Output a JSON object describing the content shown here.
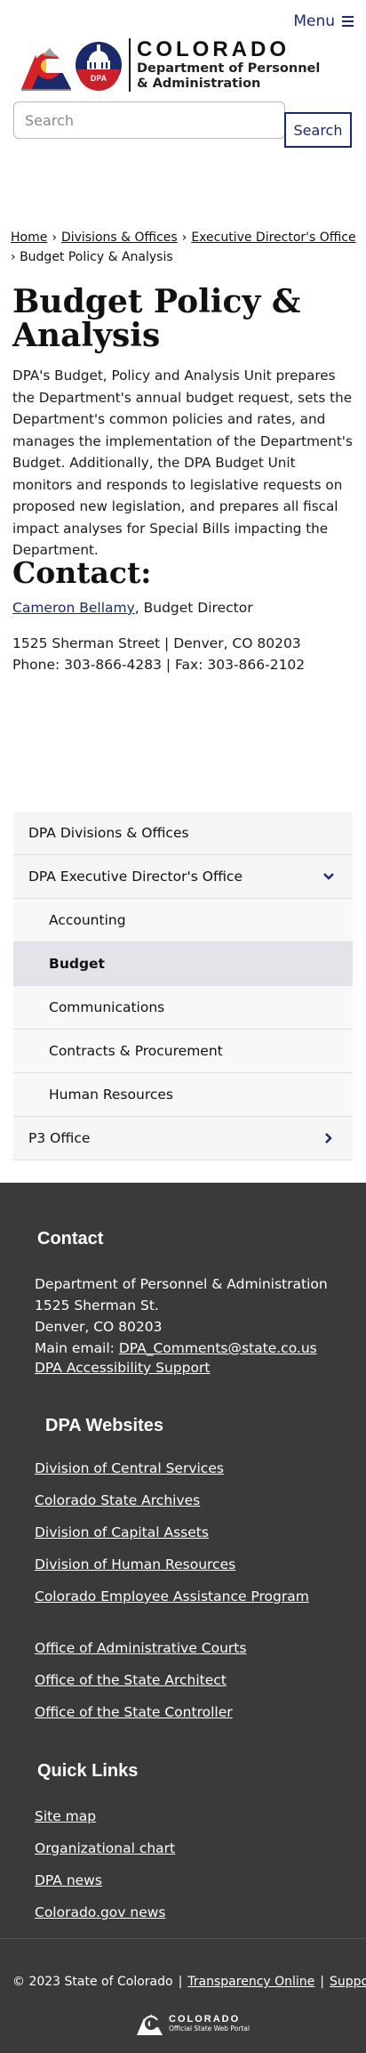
{
  "header": {
    "menu_label": "Menu",
    "logo_state": "COLORADO",
    "logo_dept_line1": "Department of Personnel",
    "logo_dept_line2": "& Administration",
    "logo_badge": "DPA",
    "search_placeholder": "Search",
    "search_button": "Search"
  },
  "breadcrumb": {
    "items": [
      "Home",
      "Divisions & Offices",
      "Executive Director's Office"
    ],
    "current": "Budget Policy & Analysis",
    "separator": "›"
  },
  "main": {
    "title": "Budget Policy & Analysis",
    "intro": "DPA's Budget, Policy and Analysis Unit prepares the Department's annual budget request, sets the Department's common policies and rates, and manages the implementation of the Department's Budget. Additionally, the DPA Budget Unit monitors and responds to legislative requests on proposed new legislation, and prepares all fiscal impact analyses for Special Bills impacting the Department.",
    "contact_heading": "Contact:",
    "contact_name": "Cameron Bellamy",
    "contact_role": ", Budget Director",
    "address_line": "1525 Sherman Street | Denver, CO 80203",
    "phone_line": "Phone: 303-866-4283 | Fax: 303-866-2102"
  },
  "sidenav": {
    "items": [
      {
        "label": "DPA Divisions & Offices"
      },
      {
        "label": "DPA Executive Director's Office",
        "icon": "chevron-down-icon"
      },
      {
        "label": "Accounting"
      },
      {
        "label": "Budget"
      },
      {
        "label": "Communications"
      },
      {
        "label": "Contracts & Procurement"
      },
      {
        "label": "Human Resources"
      },
      {
        "label": "P3 Office",
        "icon": "chevron-right-icon"
      }
    ]
  },
  "footer": {
    "contact_heading": "Contact",
    "contact_lines": [
      "Department of Personnel & Administration",
      "1525 Sherman St.",
      "Denver, CO 80203"
    ],
    "email_label": "Main email: ",
    "email": "DPA_Comments@state.co.us",
    "accessibility": "DPA Accessibility Support",
    "websites_heading": "DPA Websites",
    "websites": [
      "Division of Central Services",
      "Colorado State Archives",
      "Division of Capital Assets",
      "Division of Human Resources",
      "Colorado Employee Assistance Program"
    ],
    "websites_2": [
      "Office of Administrative Courts",
      "Office of the State Architect",
      "Office of the State Controller"
    ],
    "quick_heading": "Quick Links",
    "quick_links": [
      "Site map",
      "Organizational chart",
      "DPA news",
      "Colorado.gov news"
    ],
    "copyright": "© 2023 State of Colorado",
    "transparency": "Transparency Online",
    "support": "Support",
    "portal_title": "COLORADO",
    "portal_sub": "Official State Web Portal"
  },
  "colors": {
    "brand_navy": "#1a2a6c",
    "footer_bg": "#3a3a3a",
    "nav_bg": "#f5f5f5",
    "nav_active": "#e3e4e9"
  }
}
